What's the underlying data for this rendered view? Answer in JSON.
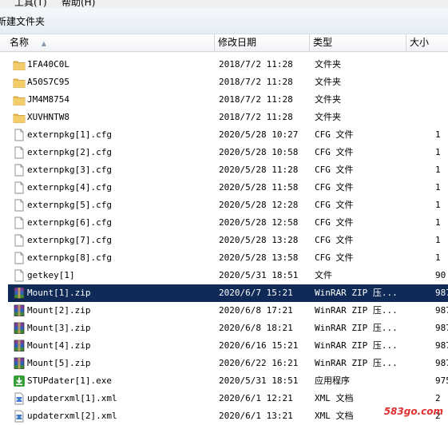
{
  "menu": {
    "tools": "工具(T)",
    "help": "帮助(H)"
  },
  "toolbar": {
    "new_folder": "新建文件夹"
  },
  "columns": {
    "name": "名称",
    "date": "修改日期",
    "type": "类型",
    "size": "大小"
  },
  "files": [
    {
      "name": "1FA40C0L",
      "date": "2018/7/2 11:28",
      "type": "文件夹",
      "size": "",
      "icon": "folder-icon"
    },
    {
      "name": "A50S7C95",
      "date": "2018/7/2 11:28",
      "type": "文件夹",
      "size": "",
      "icon": "folder-icon"
    },
    {
      "name": "JM4M8754",
      "date": "2018/7/2 11:28",
      "type": "文件夹",
      "size": "",
      "icon": "folder-icon"
    },
    {
      "name": "XUVHNTW8",
      "date": "2018/7/2 11:28",
      "type": "文件夹",
      "size": "",
      "icon": "folder-icon"
    },
    {
      "name": "externpkg[1].cfg",
      "date": "2020/5/28 10:27",
      "type": "CFG 文件",
      "size": "1",
      "icon": "file-icon"
    },
    {
      "name": "externpkg[2].cfg",
      "date": "2020/5/28 10:58",
      "type": "CFG 文件",
      "size": "1",
      "icon": "file-icon"
    },
    {
      "name": "externpkg[3].cfg",
      "date": "2020/5/28 11:28",
      "type": "CFG 文件",
      "size": "1",
      "icon": "file-icon"
    },
    {
      "name": "externpkg[4].cfg",
      "date": "2020/5/28 11:58",
      "type": "CFG 文件",
      "size": "1",
      "icon": "file-icon"
    },
    {
      "name": "externpkg[5].cfg",
      "date": "2020/5/28 12:28",
      "type": "CFG 文件",
      "size": "1",
      "icon": "file-icon"
    },
    {
      "name": "externpkg[6].cfg",
      "date": "2020/5/28 12:58",
      "type": "CFG 文件",
      "size": "1",
      "icon": "file-icon"
    },
    {
      "name": "externpkg[7].cfg",
      "date": "2020/5/28 13:28",
      "type": "CFG 文件",
      "size": "1",
      "icon": "file-icon"
    },
    {
      "name": "externpkg[8].cfg",
      "date": "2020/5/28 13:58",
      "type": "CFG 文件",
      "size": "1",
      "icon": "file-icon"
    },
    {
      "name": "getkey[1]",
      "date": "2020/5/31 18:51",
      "type": "文件",
      "size": "90",
      "icon": "file-icon"
    },
    {
      "name": "Mount[1].zip",
      "date": "2020/6/7 15:21",
      "type": "WinRAR ZIP 压...",
      "size": "987",
      "icon": "winrar-icon",
      "selected": true
    },
    {
      "name": "Mount[2].zip",
      "date": "2020/6/8 17:21",
      "type": "WinRAR ZIP 压...",
      "size": "987",
      "icon": "winrar-icon"
    },
    {
      "name": "Mount[3].zip",
      "date": "2020/6/8 18:21",
      "type": "WinRAR ZIP 压...",
      "size": "987",
      "icon": "winrar-icon"
    },
    {
      "name": "Mount[4].zip",
      "date": "2020/6/16 15:21",
      "type": "WinRAR ZIP 压...",
      "size": "987",
      "icon": "winrar-icon"
    },
    {
      "name": "Mount[5].zip",
      "date": "2020/6/22 16:21",
      "type": "WinRAR ZIP 压...",
      "size": "987",
      "icon": "winrar-icon"
    },
    {
      "name": "STUPdater[1].exe",
      "date": "2020/5/31 18:51",
      "type": "应用程序",
      "size": "975",
      "icon": "installer-icon"
    },
    {
      "name": "updaterxml[1].xml",
      "date": "2020/6/1 12:21",
      "type": "XML 文档",
      "size": "2",
      "icon": "xml-icon"
    },
    {
      "name": "updaterxml[2].xml",
      "date": "2020/6/1 13:21",
      "type": "XML 文档",
      "size": "2",
      "icon": "xml-icon"
    }
  ],
  "watermark": "583go.com",
  "colors": {
    "selection": "#0f2a56",
    "folder": "#e8b84a",
    "header_border": "#d5d5d5"
  }
}
